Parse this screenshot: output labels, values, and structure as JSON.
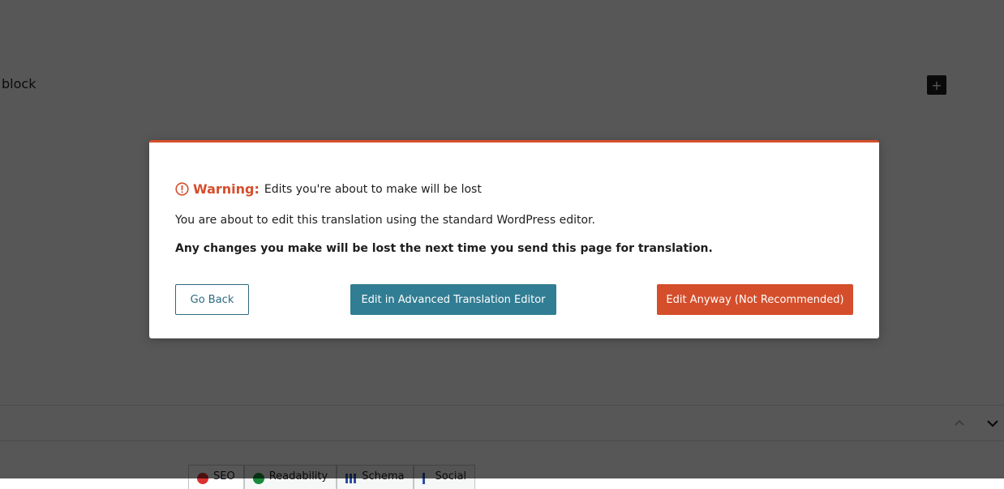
{
  "background": {
    "block_hint": "block",
    "add_block_symbol": "+",
    "tabs": [
      {
        "label": "SEO",
        "icon": "seo-score-dot"
      },
      {
        "label": "Readability",
        "icon": "readability-dot"
      },
      {
        "label": "Schema",
        "icon": "schema-columns-icon"
      },
      {
        "label": "Social",
        "icon": "social-icon"
      }
    ]
  },
  "modal": {
    "warning_label": "Warning:",
    "warning_text": "Edits you're about to make will be lost",
    "line1": "You are about to edit this translation using the standard WordPress editor.",
    "line2": "Any changes you make will be lost the next time you send this page for translation.",
    "buttons": {
      "back": "Go Back",
      "advanced": "Edit in Advanced Translation Editor",
      "anyway": "Edit Anyway (Not Recommended)"
    }
  },
  "colors": {
    "accent_orange": "#d54e2b",
    "accent_teal": "#317d93"
  }
}
